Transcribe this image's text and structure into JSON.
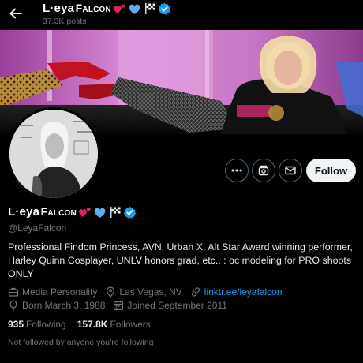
{
  "header": {
    "name": "L·eya",
    "name_caps": "Falcon",
    "posts": "37.3K posts"
  },
  "icons": {
    "back": "arrow-left-icon",
    "name_emojis": [
      "two-hearts-icon",
      "blue-heart-icon",
      "checkered-flag-icon"
    ],
    "verified": "verified-badge-icon",
    "more": "more-icon",
    "subscribe": "subscribe-icon",
    "message": "message-icon",
    "work": "briefcase-icon",
    "location": "location-pin-icon",
    "link": "link-icon",
    "birthday": "balloon-icon",
    "joined": "calendar-icon"
  },
  "actions": {
    "follow_label": "Follow"
  },
  "profile": {
    "name": "L·eya",
    "name_caps": "Falcon",
    "handle": "@LeyaFalcon",
    "bio": "Professional Findom Princess, AVN, Urban X, Alt Star Award winning performer, Harley Quinn Cosplayer, UNLV honors grad, etc., : oc modeling for PRO shoots ONLY",
    "category": "Media Personality",
    "location": "Las Vegas, NV",
    "link": "linktr.ee/leyafalcon",
    "born": "Born March 3, 1988",
    "joined": "Joined September 2011",
    "following_count": "935",
    "following_label": "Following",
    "followers_count": "157.8K",
    "followers_label": "Followers",
    "followed_by": "Not followed by anyone you’re following"
  },
  "colors": {
    "background": "#000000",
    "accent": "#1d9bf0",
    "muted": "#71767b",
    "banner_pink": "#c76fc4"
  }
}
